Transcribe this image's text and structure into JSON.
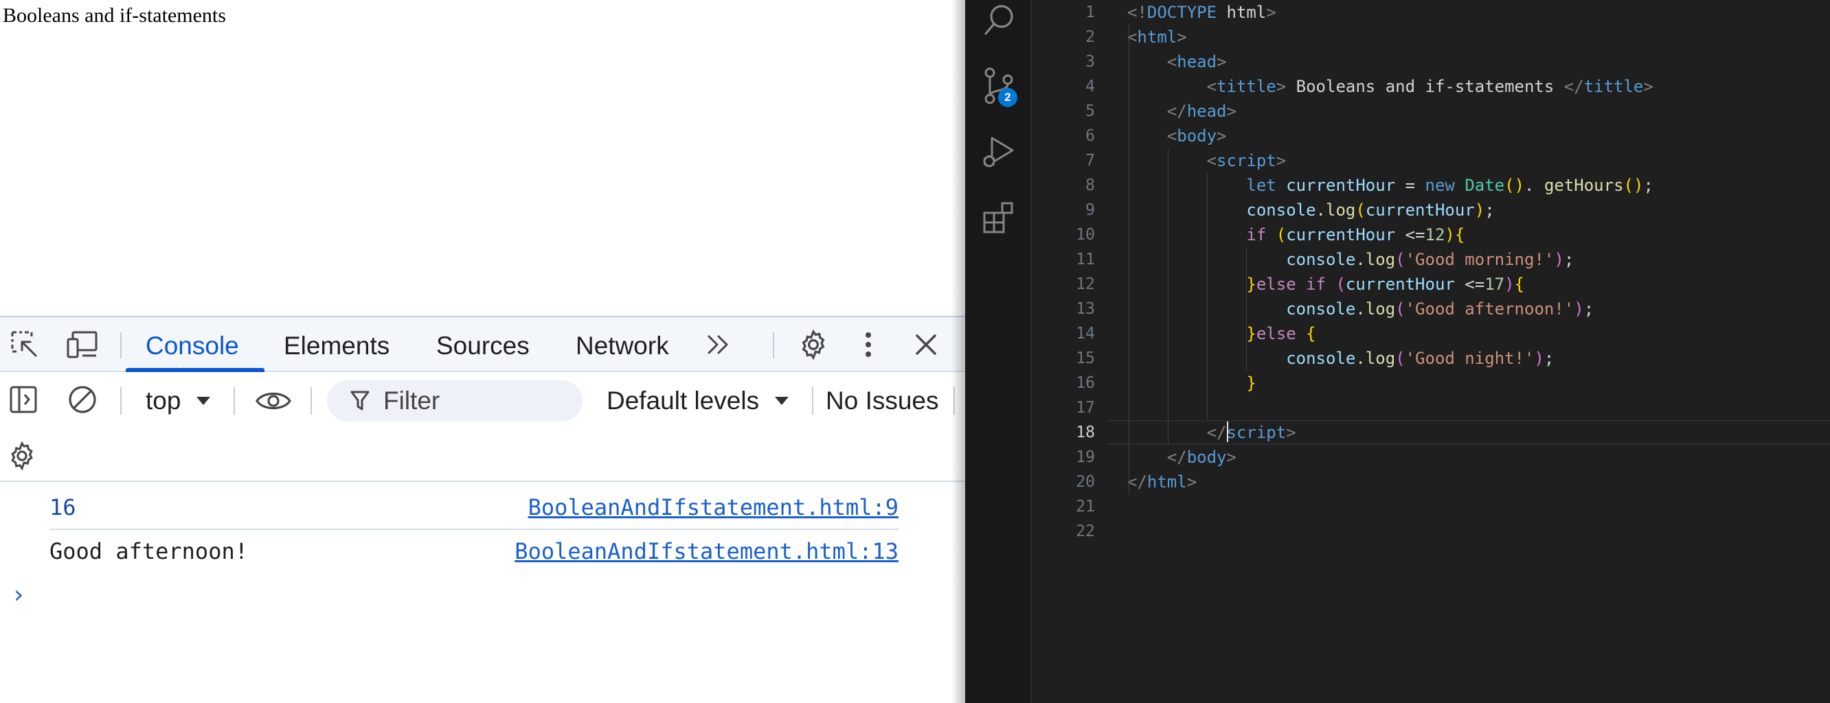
{
  "browser": {
    "page_text": "Booleans and if-statements"
  },
  "devtools": {
    "tabs": [
      {
        "label": "Console",
        "active": true
      },
      {
        "label": "Elements"
      },
      {
        "label": "Sources"
      },
      {
        "label": "Network"
      }
    ],
    "toolbar": {
      "context": "top",
      "filter_placeholder": "Filter",
      "levels": "Default levels",
      "issues": "No Issues"
    },
    "logs": [
      {
        "message": "16",
        "source": "BooleanAndIfstatement.html:9"
      },
      {
        "message": "Good afternoon!",
        "source": "BooleanAndIfstatement.html:13"
      }
    ],
    "prompt": "›",
    "accent_color": "#0b57d0"
  },
  "editor": {
    "activity_bar": {
      "icons": [
        "search-icon",
        "source-control-icon",
        "run-debug-icon",
        "extensions-icon"
      ],
      "scm_badge": "2"
    },
    "active_line": 18,
    "line_numbers": [
      "1",
      "2",
      "3",
      "4",
      "5",
      "6",
      "7",
      "8",
      "9",
      "10",
      "11",
      "12",
      "13",
      "14",
      "15",
      "16",
      "17",
      "18",
      "19",
      "20",
      "21",
      "22"
    ],
    "lines": [
      [
        [
          "t-punc",
          "<!"
        ],
        [
          "t-tag",
          "DOCTYPE"
        ],
        [
          "t-text",
          " html"
        ],
        [
          "t-punc",
          ">"
        ]
      ],
      [
        [
          "t-punc",
          "<"
        ],
        [
          "t-tag",
          "html"
        ],
        [
          "t-punc",
          ">"
        ]
      ],
      [
        [
          "t-text",
          "    "
        ],
        [
          "t-punc",
          "<"
        ],
        [
          "t-tag",
          "head"
        ],
        [
          "t-punc",
          ">"
        ]
      ],
      [
        [
          "t-text",
          "        "
        ],
        [
          "t-punc",
          "<"
        ],
        [
          "t-tag",
          "tittle"
        ],
        [
          "t-punc",
          ">"
        ],
        [
          "t-text",
          " Booleans and if-statements "
        ],
        [
          "t-punc",
          "</"
        ],
        [
          "t-tag",
          "tittle"
        ],
        [
          "t-punc",
          ">"
        ]
      ],
      [
        [
          "t-text",
          "    "
        ],
        [
          "t-punc",
          "</"
        ],
        [
          "t-tag",
          "head"
        ],
        [
          "t-punc",
          ">"
        ]
      ],
      [
        [
          "t-text",
          "    "
        ],
        [
          "t-punc",
          "<"
        ],
        [
          "t-tag",
          "body"
        ],
        [
          "t-punc",
          ">"
        ]
      ],
      [
        [
          "t-text",
          "        "
        ],
        [
          "t-punc",
          "<"
        ],
        [
          "t-tag",
          "script"
        ],
        [
          "t-punc",
          ">"
        ]
      ],
      [
        [
          "t-text",
          "            "
        ],
        [
          "t-kw",
          "let"
        ],
        [
          "t-text",
          " "
        ],
        [
          "t-var",
          "currentHour"
        ],
        [
          "t-op",
          " = "
        ],
        [
          "t-kw",
          "new"
        ],
        [
          "t-text",
          " "
        ],
        [
          "t-cls",
          "Date"
        ],
        [
          "t-br1",
          "()"
        ],
        [
          "t-op",
          ". "
        ],
        [
          "t-fn",
          "getHours"
        ],
        [
          "t-br1",
          "()"
        ],
        [
          "t-op",
          ";"
        ]
      ],
      [
        [
          "t-text",
          "            "
        ],
        [
          "t-var",
          "console"
        ],
        [
          "t-op",
          "."
        ],
        [
          "t-fn",
          "log"
        ],
        [
          "t-br1",
          "("
        ],
        [
          "t-var",
          "currentHour"
        ],
        [
          "t-br1",
          ")"
        ],
        [
          "t-op",
          ";"
        ]
      ],
      [
        [
          "t-text",
          "            "
        ],
        [
          "t-ctl",
          "if"
        ],
        [
          "t-text",
          " "
        ],
        [
          "t-br1",
          "("
        ],
        [
          "t-var",
          "currentHour"
        ],
        [
          "t-op",
          " <="
        ],
        [
          "t-num",
          "12"
        ],
        [
          "t-br1",
          ")"
        ],
        [
          "t-br1",
          "{"
        ]
      ],
      [
        [
          "t-text",
          "                "
        ],
        [
          "t-var",
          "console"
        ],
        [
          "t-op",
          "."
        ],
        [
          "t-fn",
          "log"
        ],
        [
          "t-br2",
          "("
        ],
        [
          "t-str",
          "'Good morning!'"
        ],
        [
          "t-br2",
          ")"
        ],
        [
          "t-op",
          ";"
        ]
      ],
      [
        [
          "t-text",
          "            "
        ],
        [
          "t-br1",
          "}"
        ],
        [
          "t-ctl",
          "else if"
        ],
        [
          "t-text",
          " "
        ],
        [
          "t-br2",
          "("
        ],
        [
          "t-var",
          "currentHour"
        ],
        [
          "t-op",
          " <="
        ],
        [
          "t-num",
          "17"
        ],
        [
          "t-br2",
          ")"
        ],
        [
          "t-br1",
          "{"
        ]
      ],
      [
        [
          "t-text",
          "                "
        ],
        [
          "t-var",
          "console"
        ],
        [
          "t-op",
          "."
        ],
        [
          "t-fn",
          "log"
        ],
        [
          "t-br2",
          "("
        ],
        [
          "t-str",
          "'Good afternoon!'"
        ],
        [
          "t-br2",
          ")"
        ],
        [
          "t-op",
          ";"
        ]
      ],
      [
        [
          "t-text",
          "            "
        ],
        [
          "t-br1",
          "}"
        ],
        [
          "t-ctl",
          "else"
        ],
        [
          "t-text",
          " "
        ],
        [
          "t-br1",
          "{"
        ]
      ],
      [
        [
          "t-text",
          "                "
        ],
        [
          "t-var",
          "console"
        ],
        [
          "t-op",
          "."
        ],
        [
          "t-fn",
          "log"
        ],
        [
          "t-br2",
          "("
        ],
        [
          "t-str",
          "'Good night!'"
        ],
        [
          "t-br2",
          ")"
        ],
        [
          "t-op",
          ";"
        ]
      ],
      [
        [
          "t-text",
          "            "
        ],
        [
          "t-br1",
          "}"
        ]
      ],
      [
        [
          "t-text",
          ""
        ]
      ],
      [
        [
          "t-text",
          "        "
        ],
        [
          "t-punc",
          "</"
        ],
        [
          "t-tag",
          "script"
        ],
        [
          "t-punc",
          ">"
        ]
      ],
      [
        [
          "t-text",
          "    "
        ],
        [
          "t-punc",
          "</"
        ],
        [
          "t-tag",
          "body"
        ],
        [
          "t-punc",
          ">"
        ]
      ],
      [
        [
          "t-punc",
          "</"
        ],
        [
          "t-tag",
          "html"
        ],
        [
          "t-punc",
          ">"
        ]
      ],
      [
        [
          "t-text",
          ""
        ]
      ],
      [
        [
          "t-text",
          ""
        ]
      ]
    ]
  }
}
